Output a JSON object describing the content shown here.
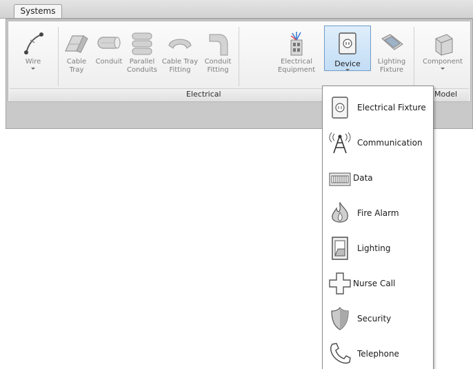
{
  "tabs": {
    "active": "Systems"
  },
  "ribbon": {
    "tools": [
      {
        "label": "Wire",
        "icon": "wire-icon",
        "has_dropdown": true
      },
      {
        "label": "Cable\nTray",
        "icon": "cable-tray-icon"
      },
      {
        "label": "Conduit",
        "icon": "conduit-icon"
      },
      {
        "label": "Parallel\nConduits",
        "icon": "parallel-conduits-icon"
      },
      {
        "label": "Cable Tray\nFitting",
        "icon": "cable-tray-fitting-icon"
      },
      {
        "label": "Conduit\nFitting",
        "icon": "conduit-fitting-icon"
      },
      {
        "label": "Electrical\nEquipment",
        "icon": "electrical-equipment-icon"
      },
      {
        "label": "Device",
        "icon": "device-icon",
        "has_dropdown": true,
        "active": true
      },
      {
        "label": "Lighting\nFixture",
        "icon": "lighting-fixture-icon"
      },
      {
        "label": "Component",
        "icon": "component-icon",
        "has_dropdown": true
      }
    ],
    "panels": {
      "electrical": "Electrical",
      "model": "Model"
    }
  },
  "device_menu": {
    "items": [
      {
        "label": "Electrical Fixture",
        "icon": "electrical-fixture-icon"
      },
      {
        "label": "Communication",
        "icon": "communication-icon"
      },
      {
        "label": "Data",
        "icon": "data-icon"
      },
      {
        "label": "Fire Alarm",
        "icon": "fire-alarm-icon"
      },
      {
        "label": "Lighting",
        "icon": "lighting-switch-icon"
      },
      {
        "label": "Nurse Call",
        "icon": "nurse-call-icon"
      },
      {
        "label": "Security",
        "icon": "security-icon"
      },
      {
        "label": "Telephone",
        "icon": "telephone-icon"
      }
    ]
  },
  "colors": {
    "active_tool_border": "#6d9bc8",
    "active_tool_fill": "#c3ddf5",
    "electrical_equipment_accent": "#3d7fd6"
  }
}
